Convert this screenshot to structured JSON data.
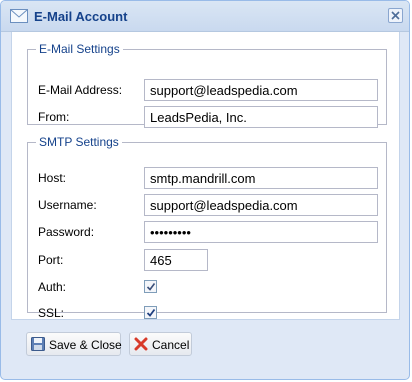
{
  "window": {
    "title": "E-Mail Account",
    "icon": "envelope-icon"
  },
  "email_settings": {
    "legend": "E-Mail Settings",
    "address_label": "E-Mail Address:",
    "address_value": "support@leadspedia.com",
    "from_label": "From:",
    "from_value": "LeadsPedia, Inc."
  },
  "smtp_settings": {
    "legend": "SMTP Settings",
    "host_label": "Host:",
    "host_value": "smtp.mandrill.com",
    "username_label": "Username:",
    "username_value": "support@leadspedia.com",
    "password_label": "Password:",
    "password_value": "•••••••••",
    "port_label": "Port:",
    "port_value": "465",
    "auth_label": "Auth:",
    "auth_checked": true,
    "ssl_label": "SSL:",
    "ssl_checked": true
  },
  "buttons": {
    "save_label": "Save & Close",
    "cancel_label": "Cancel"
  },
  "colors": {
    "title": "#15428b",
    "window_bg": "#dfe8f6",
    "border": "#99bbe8"
  }
}
